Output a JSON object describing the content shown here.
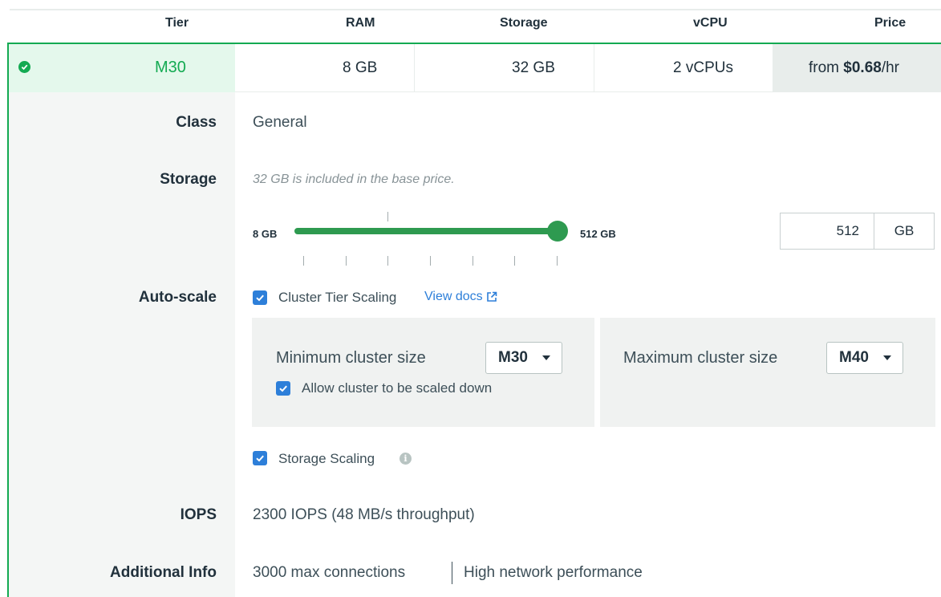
{
  "header": {
    "tier": "Tier",
    "ram": "RAM",
    "storage": "Storage",
    "vcpu": "vCPU",
    "price": "Price"
  },
  "tier_row": {
    "name": "M30",
    "ram": "8 GB",
    "storage": "32 GB",
    "vcpu": "2 vCPUs",
    "price_prefix": "from ",
    "price_value": "$0.68",
    "price_suffix": "/hr"
  },
  "rows": {
    "class_label": "Class",
    "class_value": "General",
    "storage_label": "Storage",
    "storage_note": "32 GB is included in the base price.",
    "autoscale_label": "Auto-scale",
    "iops_label": "IOPS",
    "iops_value": "2300 IOPS (48 MB/s throughput)",
    "additional_label": "Additional Info",
    "additional_value_1": "3000 max connections",
    "additional_value_2": "High network performance"
  },
  "slider": {
    "min_label": "8 GB",
    "max_label": "512 GB",
    "value_fraction": 1.0
  },
  "storage_input": {
    "value": "512",
    "unit": "GB"
  },
  "autoscale": {
    "cluster_tier_label": "Cluster Tier Scaling",
    "view_docs": "View docs",
    "min_label": "Minimum cluster size",
    "min_value": "M30",
    "allow_down_label": "Allow cluster to be scaled down",
    "max_label": "Maximum cluster size",
    "max_value": "M40",
    "storage_scaling_label": "Storage Scaling"
  },
  "colors": {
    "accent_green": "#13aa52",
    "checkbox_blue": "#2d7fd9",
    "link_blue": "#2d7fd9"
  }
}
